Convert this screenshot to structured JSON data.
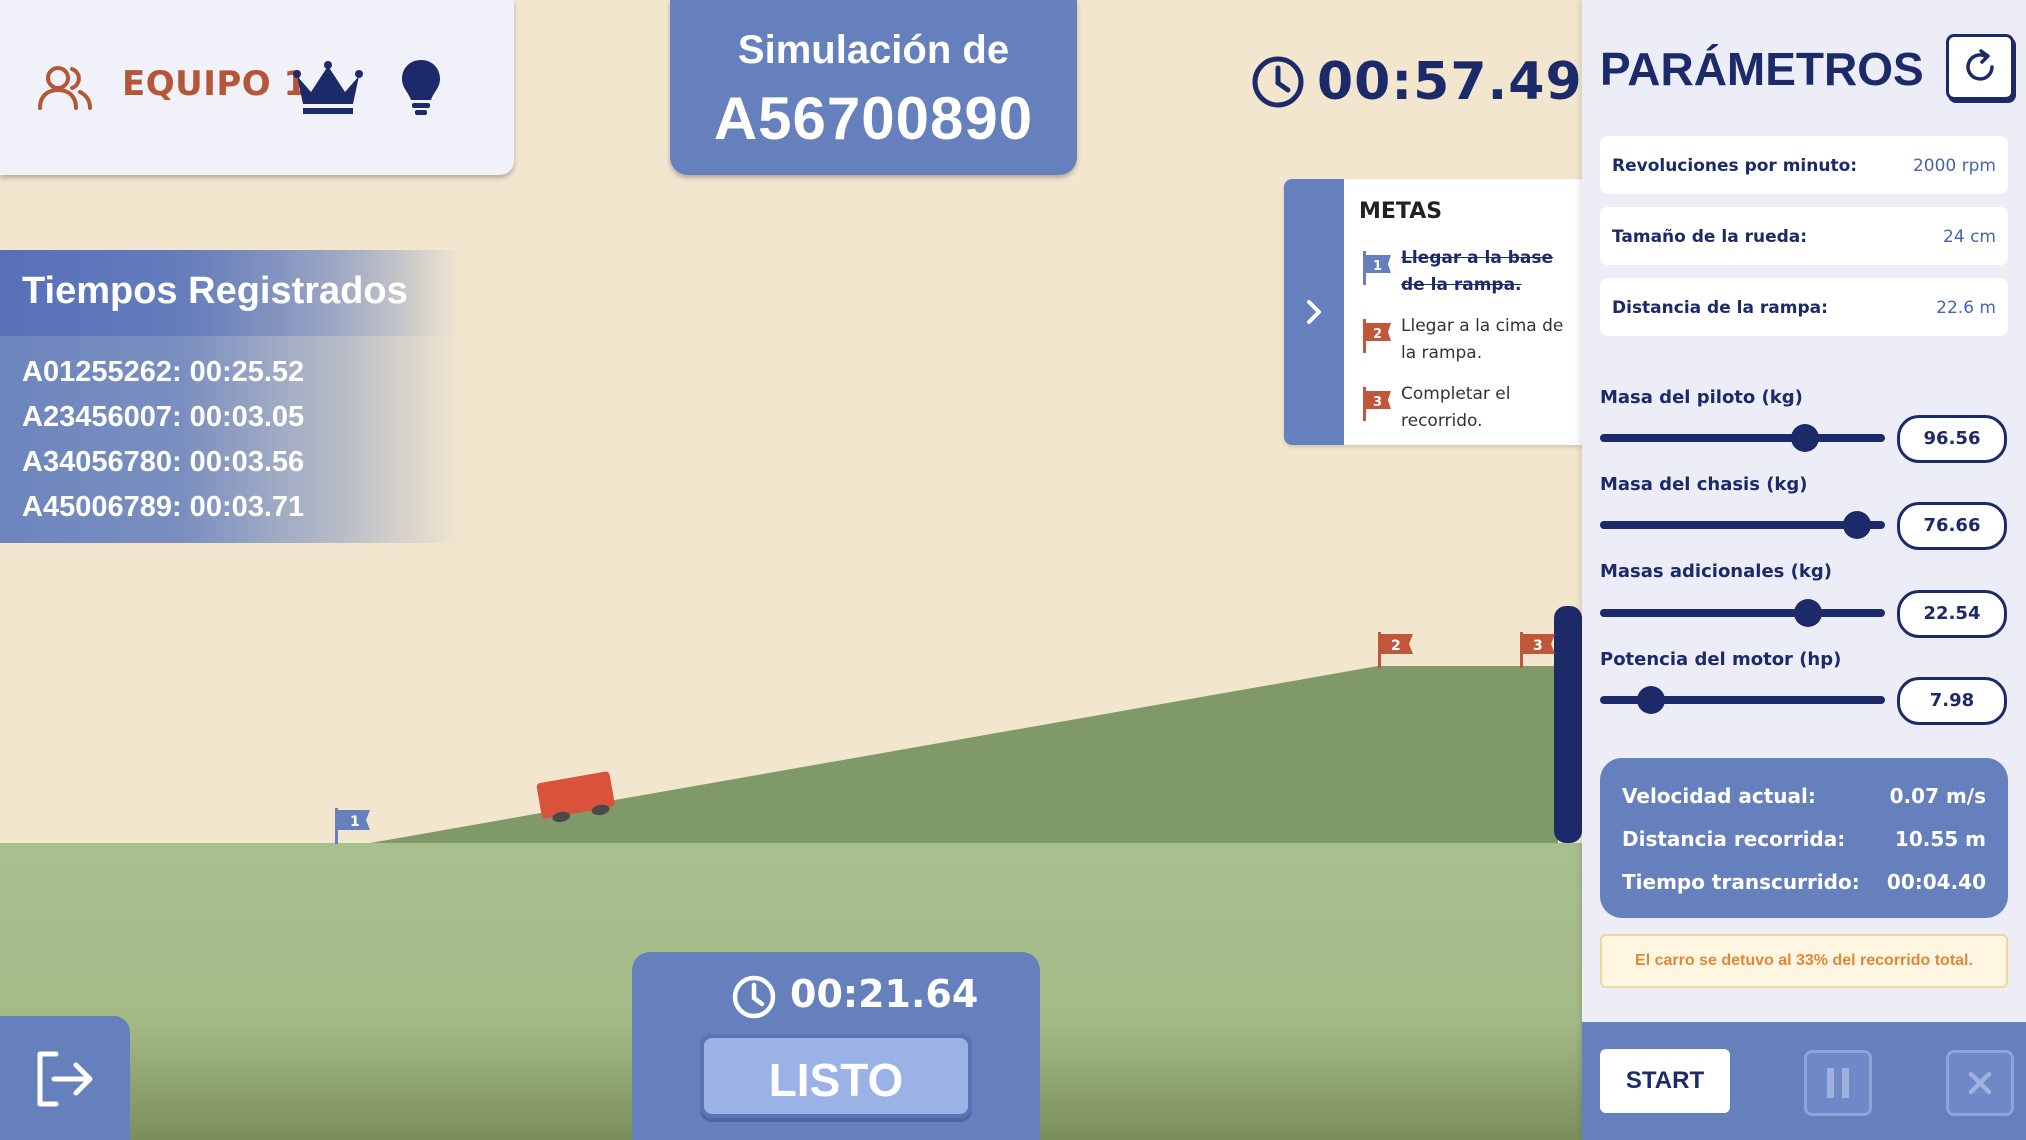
{
  "header": {
    "team": "EQUIPO 1",
    "sim_title_line1": "Simulación de",
    "sim_title_line2": "A56700890",
    "main_timer": "00:57.49"
  },
  "records": {
    "title": "Tiempos Registrados",
    "entries": [
      "A01255262: 00:25.52",
      "A23456007: 00:03.05",
      "A34056780: 00:03.56",
      "A45006789: 00:03.71"
    ]
  },
  "goals": {
    "title": "METAS",
    "items": [
      {
        "num": "1",
        "text": "Llegar a la base de la rampa.",
        "done": true
      },
      {
        "num": "2",
        "text": "Llegar a la cima de la rampa.",
        "done": false
      },
      {
        "num": "3",
        "text": "Completar el recorrido.",
        "done": false
      }
    ]
  },
  "scene": {
    "flags": [
      "1",
      "2",
      "3"
    ],
    "progress_percent": 33
  },
  "bottom": {
    "timer": "00:21.64",
    "ready_label": "LISTO"
  },
  "panel": {
    "title": "PARÁMETROS",
    "params": [
      {
        "label": "Revoluciones por minuto:",
        "value": "2000 rpm"
      },
      {
        "label": "Tamaño de la rueda:",
        "value": "24 cm"
      },
      {
        "label": "Distancia de la rampa:",
        "value": "22.6 m"
      }
    ],
    "sliders": [
      {
        "label": "Masa del piloto (kg)",
        "value": "96.56",
        "fraction": 0.72
      },
      {
        "label": "Masa del chasis (kg)",
        "value": "76.66",
        "fraction": 0.9
      },
      {
        "label": "Masas adicionales (kg)",
        "value": "22.54",
        "fraction": 0.73
      },
      {
        "label": "Potencia del motor (hp)",
        "value": "7.98",
        "fraction": 0.18
      }
    ],
    "stats": [
      {
        "label": "Velocidad actual:",
        "value": "0.07 m/s"
      },
      {
        "label": "Distancia recorrida:",
        "value": "10.55 m"
      },
      {
        "label": "Tiempo transcurrido:",
        "value": "00:04.40"
      }
    ],
    "notice": "El carro se detuvo al 33% del recorrido total.",
    "start_label": "START"
  },
  "colors": {
    "sky": "#f2e6cf",
    "ground": "#a8bf8e",
    "ramp": "#7f9a68",
    "navy": "#1d2a6a",
    "blue": "#6580bd",
    "flag_red": "#c0573a",
    "car": "#d9533c"
  }
}
